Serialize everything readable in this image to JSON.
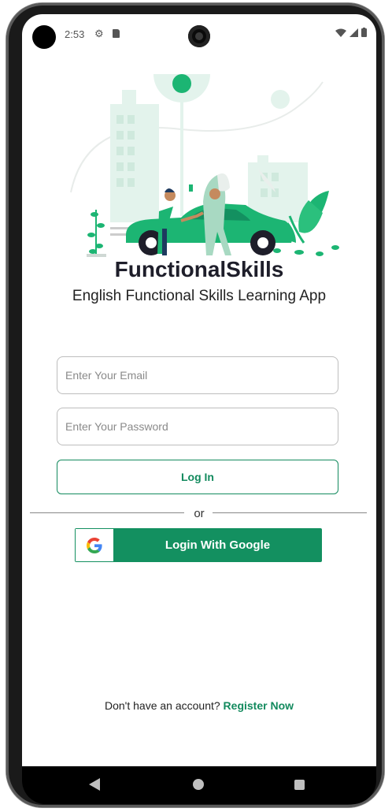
{
  "status_bar": {
    "time": "2:53",
    "icons": [
      "gear-icon",
      "sd-card-icon",
      "wifi-icon",
      "signal-icon",
      "battery-icon"
    ]
  },
  "app": {
    "title": "FunctionalSkills",
    "subtitle": "English Functional Skills Learning App"
  },
  "form": {
    "email_placeholder": "Enter Your Email",
    "password_placeholder": "Enter Your Password",
    "login_label": "Log In",
    "or_label": "or",
    "google_label": "Login With Google"
  },
  "footer": {
    "prompt": "Don't have an account?",
    "register_label": "Register Now"
  },
  "colors": {
    "accent": "#138a5e",
    "illustration_light": "#e3f3ec",
    "illustration_mid": "#1cb573"
  },
  "nav": [
    "back-icon",
    "home-icon",
    "recents-icon"
  ]
}
